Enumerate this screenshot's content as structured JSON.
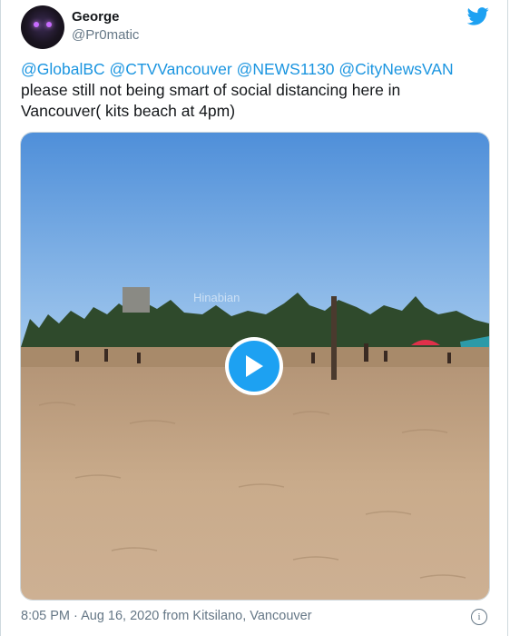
{
  "author": {
    "name": "George",
    "handle": "@Pr0matic"
  },
  "tweet": {
    "mentions": [
      "@GlobalBC",
      "@CTVVancouver",
      "@NEWS1130",
      "@CityNewsVAN"
    ],
    "text_line1": "please still not being smart of social distancing here in",
    "text_line2": "Vancouver( kits beach at 4pm)"
  },
  "media": {
    "watermark": "Hinabian"
  },
  "footer": {
    "meta": "8:05 PM · Aug 16, 2020 from Kitsilano, Vancouver",
    "info_symbol": "i"
  },
  "icons": {
    "brand": "twitter-bird-icon",
    "play": "play-icon",
    "info": "info-icon"
  },
  "colors": {
    "accent": "#1da1f2",
    "mention": "#1b95e0",
    "muted": "#657786"
  }
}
